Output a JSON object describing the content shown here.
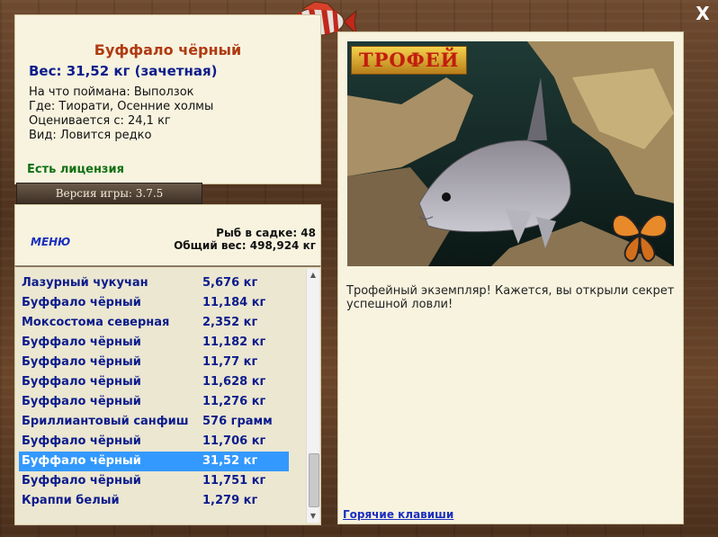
{
  "info": {
    "fish_name": "Буффало чёрный",
    "weight_line": "Вес: 31,52 кг (зачетная)",
    "lines": [
      "На что поймана: Выползок",
      "Где: Тиорати, Осенние холмы",
      "Оценивается с: 24,1 кг",
      "Вид: Ловится редко"
    ],
    "license": "Есть лицензия"
  },
  "version": "Версия игры: 3.7.5",
  "menu_label": "МЕНЮ",
  "stats": {
    "cage": "Рыб в садке: 48",
    "total": "Общий вес: 498,924 кг"
  },
  "catch_list": [
    {
      "name": "Лазурный чукучан",
      "weight": "5,676 кг"
    },
    {
      "name": "Буффало чёрный",
      "weight": "11,184 кг"
    },
    {
      "name": "Моксостома северная",
      "weight": "2,352 кг"
    },
    {
      "name": "Буффало чёрный",
      "weight": "11,182 кг"
    },
    {
      "name": "Буффало чёрный",
      "weight": "11,77 кг"
    },
    {
      "name": "Буффало чёрный",
      "weight": "11,628 кг"
    },
    {
      "name": "Буффало чёрный",
      "weight": "11,276 кг"
    },
    {
      "name": "Бриллиантовый санфиш",
      "weight": "576 грамм"
    },
    {
      "name": "Буффало чёрный",
      "weight": "11,706 кг"
    },
    {
      "name": "Буффало чёрный",
      "weight": "31,52 кг"
    },
    {
      "name": "Буффало чёрный",
      "weight": "11,751 кг"
    },
    {
      "name": "Краппи белый",
      "weight": "1,279 кг"
    }
  ],
  "selected_index": 9,
  "detail": {
    "trophy_badge": "ТРОФЕЙ",
    "description": "Трофейный экземпляр! Кажется, вы открыли секрет успешной ловли!",
    "hotkeys": "Горячие клавиши"
  },
  "close_label": "X",
  "colors": {
    "accent_title": "#b03a10",
    "weight_blue": "#0c1c8c",
    "license_green": "#127012",
    "selection": "#3399ff"
  },
  "icons": [
    "fish-logo-icon",
    "butterfly-icon",
    "close-icon",
    "scroll-up-icon",
    "scroll-down-icon"
  ]
}
